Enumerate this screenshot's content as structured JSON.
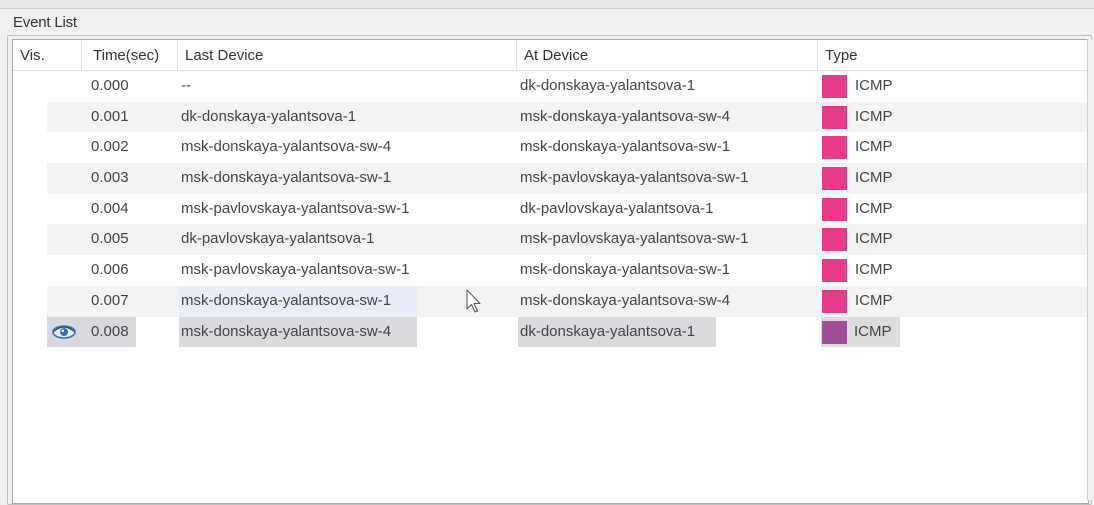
{
  "panel": {
    "title": "Event List"
  },
  "columns": {
    "vis": "Vis.",
    "time": "Time(sec)",
    "last_device": "Last Device",
    "at_device": "At Device",
    "type": "Type"
  },
  "colors": {
    "icmp_swatch": "#e8398a",
    "icmp_swatch_selected": "#a04e9a",
    "row_alt": "#f3f3f5",
    "selection": "#d9dade"
  },
  "rows": [
    {
      "time": "0.000",
      "last": "--",
      "at": "dk-donskaya-yalantsova-1",
      "type": "ICMP"
    },
    {
      "time": "0.001",
      "last": "dk-donskaya-yalantsova-1",
      "at": "msk-donskaya-yalantsova-sw-4",
      "type": "ICMP"
    },
    {
      "time": "0.002",
      "last": "msk-donskaya-yalantsova-sw-4",
      "at": "msk-donskaya-yalantsova-sw-1",
      "type": "ICMP"
    },
    {
      "time": "0.003",
      "last": "msk-donskaya-yalantsova-sw-1",
      "at": "msk-pavlovskaya-yalantsova-sw-1",
      "type": "ICMP"
    },
    {
      "time": "0.004",
      "last": "msk-pavlovskaya-yalantsova-sw-1",
      "at": "dk-pavlovskaya-yalantsova-1",
      "type": "ICMP"
    },
    {
      "time": "0.005",
      "last": "dk-pavlovskaya-yalantsova-1",
      "at": "msk-pavlovskaya-yalantsova-sw-1",
      "type": "ICMP"
    },
    {
      "time": "0.006",
      "last": "msk-pavlovskaya-yalantsova-sw-1",
      "at": "msk-donskaya-yalantsova-sw-1",
      "type": "ICMP"
    },
    {
      "time": "0.007",
      "last": "msk-donskaya-yalantsova-sw-1",
      "at": "msk-donskaya-yalantsova-sw-4",
      "type": "ICMP"
    },
    {
      "time": "0.008",
      "last": "msk-donskaya-yalantsova-sw-4",
      "at": "dk-donskaya-yalantsova-1",
      "type": "ICMP",
      "visible_icon": "eye-icon"
    }
  ]
}
